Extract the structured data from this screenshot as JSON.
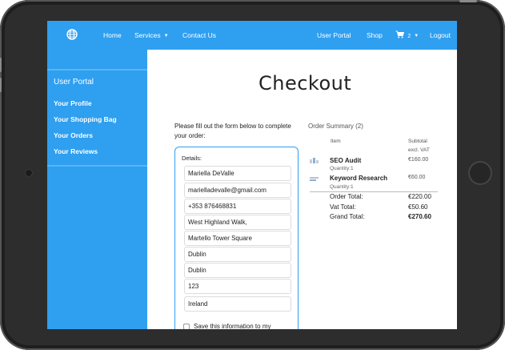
{
  "navbar": {
    "items": [
      "Home",
      "Services",
      "Contact Us"
    ],
    "right_items": [
      "User Portal",
      "Shop"
    ],
    "cart_count": "2",
    "logout": "Logout"
  },
  "sidebar": {
    "title": "User Portal",
    "links": [
      "Your Profile",
      "Your Shopping Bag",
      "Your Orders",
      "Your Reviews"
    ]
  },
  "main": {
    "title": "Checkout",
    "intro": "Please fill out the form below to complete your order:",
    "form": {
      "label": "Details:",
      "fields": [
        "Mariella DeValle",
        "marielladevalle@gmail.com",
        "+353 876468831",
        "West Highland Walk,",
        "Martello Tower Square",
        "Dublin",
        "Dublin",
        "123",
        "Ireland"
      ],
      "checkbox_label": "Save this information to my"
    }
  },
  "order_summary": {
    "title": "Order Summary (2)",
    "col_item": "Item",
    "col_subtotal_1": "Subtotal",
    "col_subtotal_2": "excl. VAT",
    "items": [
      {
        "name": "SEO Audit",
        "quantity": "Quantity:1",
        "price": "€160.00"
      },
      {
        "name": "Keyword Research",
        "quantity": "Quantity:1",
        "price": "€60.00"
      }
    ],
    "totals": [
      {
        "label": "Order Total:",
        "value": "€220.00"
      },
      {
        "label": "Vat Total:",
        "value": "€50.60"
      },
      {
        "label": "Grand Total:",
        "value": "€270.60"
      }
    ]
  },
  "colors": {
    "accent": "#2f9ff0",
    "bezel": "#2d2d2d"
  }
}
